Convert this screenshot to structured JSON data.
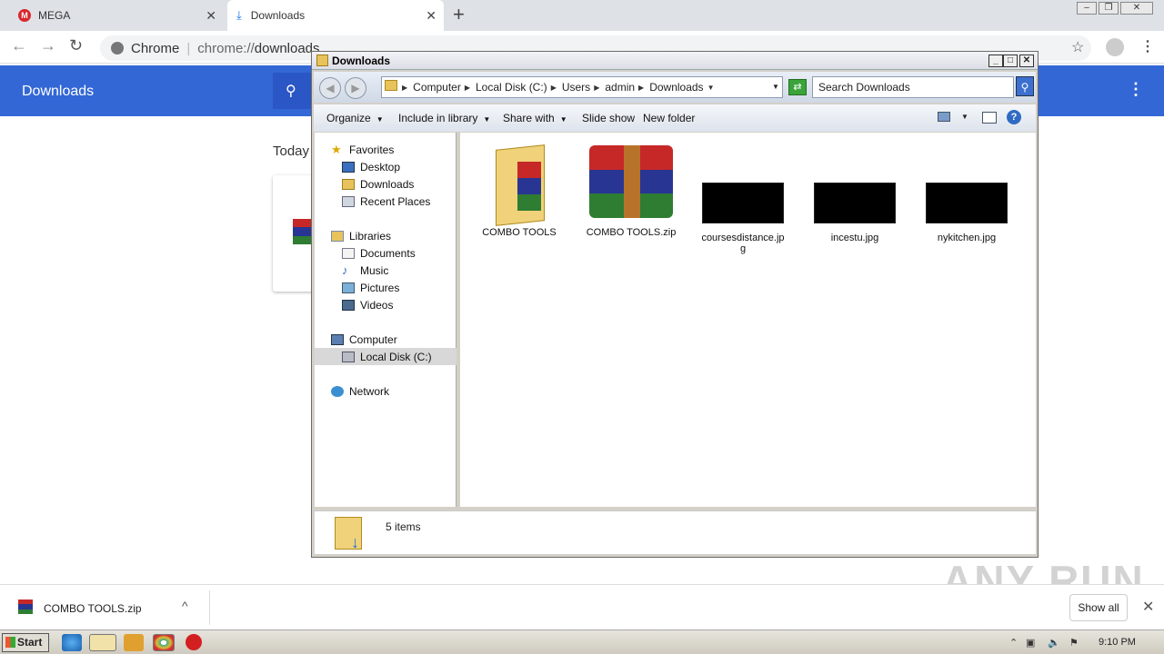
{
  "browser": {
    "tabs": [
      {
        "label": "MEGA",
        "icon": "mega-icon"
      },
      {
        "label": "Downloads",
        "icon": "download-icon"
      }
    ],
    "omnibox": {
      "site": "Chrome",
      "url_prefix": "chrome://",
      "url_path": "downloads"
    }
  },
  "downloads_page": {
    "title": "Downloads",
    "section_label": "Today"
  },
  "explorer": {
    "title": "Downloads",
    "breadcrumb": [
      "Computer",
      "Local Disk (C:)",
      "Users",
      "admin",
      "Downloads"
    ],
    "search_placeholder": "Search Downloads",
    "commands": {
      "organize": "Organize",
      "include_in_library": "Include in library",
      "share_with": "Share with",
      "slide_show": "Slide show",
      "new_folder": "New folder"
    },
    "nav": {
      "favorites": "Favorites",
      "desktop": "Desktop",
      "downloads": "Downloads",
      "recent_places": "Recent Places",
      "libraries": "Libraries",
      "documents": "Documents",
      "music": "Music",
      "pictures": "Pictures",
      "videos": "Videos",
      "computer": "Computer",
      "local_disk": "Local Disk (C:)",
      "network": "Network"
    },
    "files": [
      {
        "name": "COMBO TOOLS",
        "type": "folder"
      },
      {
        "name": "COMBO TOOLS.zip",
        "type": "winrar-archive"
      },
      {
        "name": "coursesdistance.jpg",
        "type": "image"
      },
      {
        "name": "incestu.jpg",
        "type": "image"
      },
      {
        "name": "nykitchen.jpg",
        "type": "image"
      }
    ],
    "status": "5 items"
  },
  "shelf": {
    "filename": "COMBO TOOLS.zip",
    "show_all": "Show all"
  },
  "watermark": "ANY RUN",
  "taskbar": {
    "start": "Start",
    "clock": "9:10 PM"
  },
  "colors": {
    "chrome_blue": "#3367d6",
    "xp_title": "#dcdde6"
  }
}
